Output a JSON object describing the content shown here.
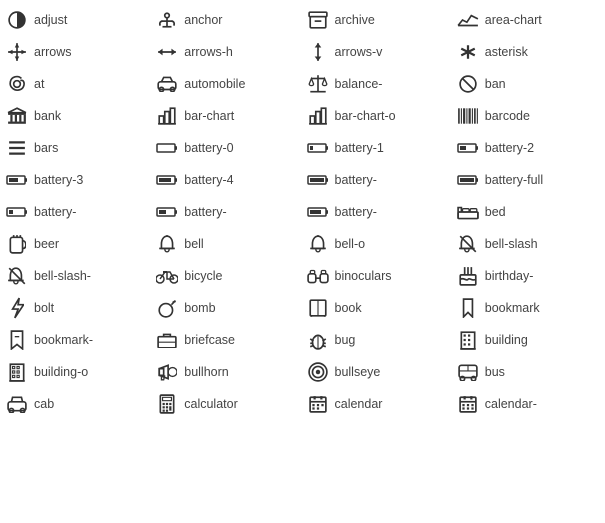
{
  "icons": [
    {
      "id": "adjust",
      "label": "adjust",
      "symbol": "◑"
    },
    {
      "id": "anchor",
      "label": "anchor",
      "symbol": "⚓"
    },
    {
      "id": "archive",
      "label": "archive",
      "symbol": "🗄"
    },
    {
      "id": "area-chart",
      "label": "area-chart",
      "symbol": "📈"
    },
    {
      "id": "arrows",
      "label": "arrows",
      "symbol": "✢"
    },
    {
      "id": "arrows-h",
      "label": "arrows-h",
      "symbol": "↔"
    },
    {
      "id": "arrows-v",
      "label": "arrows-v",
      "symbol": "↕"
    },
    {
      "id": "asterisk",
      "label": "asterisk",
      "symbol": "✳"
    },
    {
      "id": "at",
      "label": "at",
      "symbol": "@"
    },
    {
      "id": "automobile",
      "label": "automobile",
      "symbol": "🚗"
    },
    {
      "id": "balance",
      "label": "balance-",
      "symbol": "⚖"
    },
    {
      "id": "ban",
      "label": "ban",
      "symbol": "🚫"
    },
    {
      "id": "bank",
      "label": "bank",
      "symbol": "🏛"
    },
    {
      "id": "bar-chart",
      "label": "bar-chart",
      "symbol": "📊"
    },
    {
      "id": "bar-chart-o",
      "label": "bar-chart-o",
      "symbol": "📊"
    },
    {
      "id": "barcode",
      "label": "barcode",
      "symbol": "▌▐▌▐"
    },
    {
      "id": "bars",
      "label": "bars",
      "symbol": "☰"
    },
    {
      "id": "battery-0",
      "label": "battery-0",
      "symbol": "🔋"
    },
    {
      "id": "battery-1",
      "label": "battery-1",
      "symbol": "🔋"
    },
    {
      "id": "battery-2",
      "label": "battery-2",
      "symbol": "🔋"
    },
    {
      "id": "battery-3",
      "label": "battery-3",
      "symbol": "🔋"
    },
    {
      "id": "battery-4",
      "label": "battery-4",
      "symbol": "🔋"
    },
    {
      "id": "battery-5",
      "label": "battery-",
      "symbol": "🔋"
    },
    {
      "id": "battery-full",
      "label": "battery-full",
      "symbol": "🔋"
    },
    {
      "id": "battery-6",
      "label": "battery-",
      "symbol": "🔋"
    },
    {
      "id": "battery-7",
      "label": "battery-",
      "symbol": "🔋"
    },
    {
      "id": "battery-8",
      "label": "battery-",
      "symbol": "🔋"
    },
    {
      "id": "bed",
      "label": "bed",
      "symbol": "🛏"
    },
    {
      "id": "beer",
      "label": "beer",
      "symbol": "🍺"
    },
    {
      "id": "bell",
      "label": "bell",
      "symbol": "🔔"
    },
    {
      "id": "bell-o",
      "label": "bell-o",
      "symbol": "🔔"
    },
    {
      "id": "bell-slash",
      "label": "bell-slash",
      "symbol": "🔕"
    },
    {
      "id": "bell-slash-2",
      "label": "bell-slash-",
      "symbol": "🔕"
    },
    {
      "id": "bicycle",
      "label": "bicycle",
      "symbol": "🚲"
    },
    {
      "id": "binoculars",
      "label": "binoculars",
      "symbol": "🔭"
    },
    {
      "id": "birthday",
      "label": "birthday-",
      "symbol": "🎂"
    },
    {
      "id": "bolt",
      "label": "bolt",
      "symbol": "⚡"
    },
    {
      "id": "bomb",
      "label": "bomb",
      "symbol": "💣"
    },
    {
      "id": "book",
      "label": "book",
      "symbol": "📖"
    },
    {
      "id": "bookmark",
      "label": "bookmark",
      "symbol": "🔖"
    },
    {
      "id": "bookmark-2",
      "label": "bookmark-",
      "symbol": "🔖"
    },
    {
      "id": "briefcase",
      "label": "briefcase",
      "symbol": "💼"
    },
    {
      "id": "bug",
      "label": "bug",
      "symbol": "🐛"
    },
    {
      "id": "building",
      "label": "building",
      "symbol": "🏢"
    },
    {
      "id": "building-o",
      "label": "building-o",
      "symbol": "🏢"
    },
    {
      "id": "bullhorn",
      "label": "bullhorn",
      "symbol": "📢"
    },
    {
      "id": "bullseye",
      "label": "bullseye",
      "symbol": "🎯"
    },
    {
      "id": "bus",
      "label": "bus",
      "symbol": "🚌"
    },
    {
      "id": "cab",
      "label": "cab",
      "symbol": "🚕"
    },
    {
      "id": "calculator",
      "label": "calculator",
      "symbol": "🖩"
    },
    {
      "id": "calendar",
      "label": "calendar",
      "symbol": "📅"
    },
    {
      "id": "calendar-2",
      "label": "calendar-",
      "symbol": "📅"
    }
  ]
}
